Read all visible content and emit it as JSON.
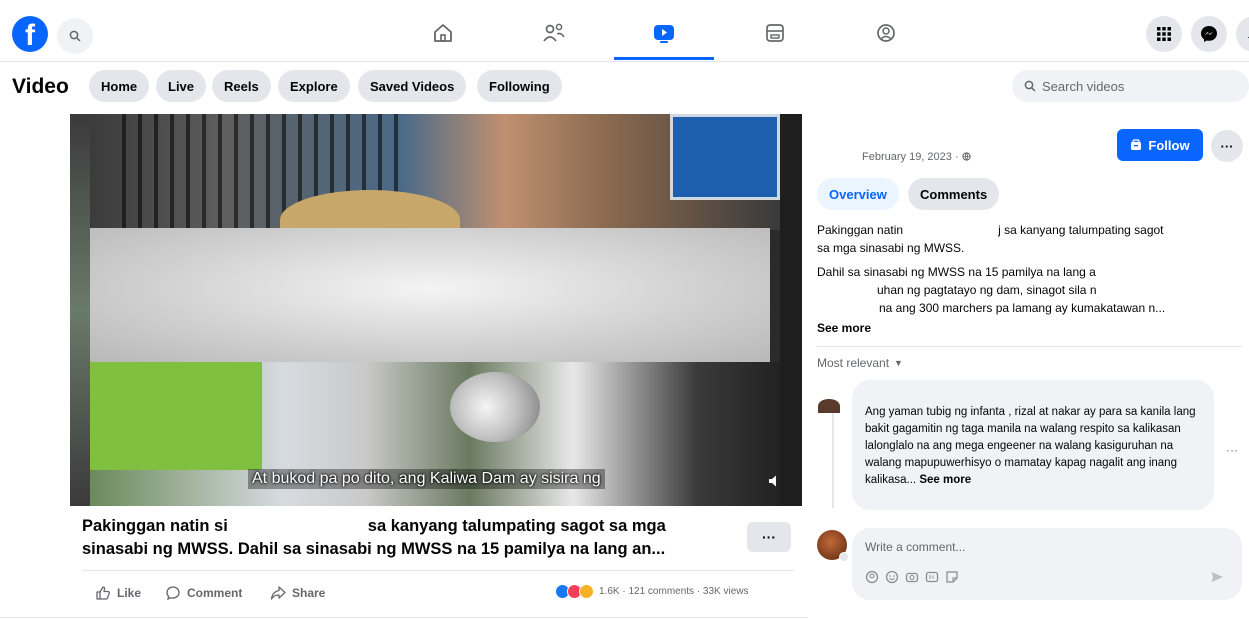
{
  "nav": {
    "logo": "f",
    "icons": [
      "search-icon",
      "home-icon",
      "friends-icon",
      "watch-icon",
      "marketplace-icon",
      "gaming-icon",
      "menu-grid-icon",
      "messenger-icon",
      "notifications-icon"
    ],
    "active": "watch"
  },
  "video_header": {
    "title": "Video",
    "pills": [
      "Home",
      "Live",
      "Reels",
      "Explore",
      "Saved Videos",
      "Following"
    ],
    "search_placeholder": "Search videos"
  },
  "player": {
    "subtitle": "At bukod pa po dito, ang Kaliwa Dam ay sisira ng"
  },
  "post": {
    "caption_part1": "Pakinggan natin si",
    "caption_part2": "sa kanyang talumpating sagot sa mga sinasabi ng MWSS. Dahil sa sinasabi ng MWSS na 15 pamilya na lang an...",
    "more_label": "···",
    "actions": {
      "like": "Like",
      "comment": "Comment",
      "share": "Share"
    },
    "stats": "1.6K · 121 comments · 33K views"
  },
  "right_panel": {
    "date": "February 19, 2023 ·",
    "follow_label": "Follow",
    "more_label": "···",
    "tabs": [
      "Overview",
      "Comments"
    ],
    "desc_line1a": "Pakinggan natin",
    "desc_line1b": "j sa kanyang talumpating sagot",
    "desc_line2": "sa mga sinasabi ng MWSS.",
    "desc_line3": "Dahil sa sinasabi ng MWSS na 15 pamilya na lang a",
    "desc_line4": "uhan ng pagtatayo ng dam, sinagot sila n",
    "desc_line5": "na ang 300 marchers pa lamang ay kumakatawan n...",
    "see_more": "See more",
    "sort_label": "Most relevant",
    "comment_text": "Ang yaman tubig ng infanta , rizal at nakar ay para sa kanila lang bakit gagamitin ng taga manila na walang respito sa kalikasan lalonglalo na ang mega engeener na walang kasiguruhan na walang mapupuwerhisyo o mamatay kapag nagalit ang inang kalikasa...",
    "comment_see_more": "See more",
    "comment_more": "···",
    "write_placeholder": "Write a comment..."
  },
  "colors": {
    "brand_blue": "#0866ff",
    "pill_gray": "#e4e6eb",
    "input_gray": "#f0f2f5",
    "text_secondary": "#65676b",
    "reaction_like": "#1877f2",
    "reaction_love": "#f33e58",
    "reaction_care": "#f7b125"
  }
}
